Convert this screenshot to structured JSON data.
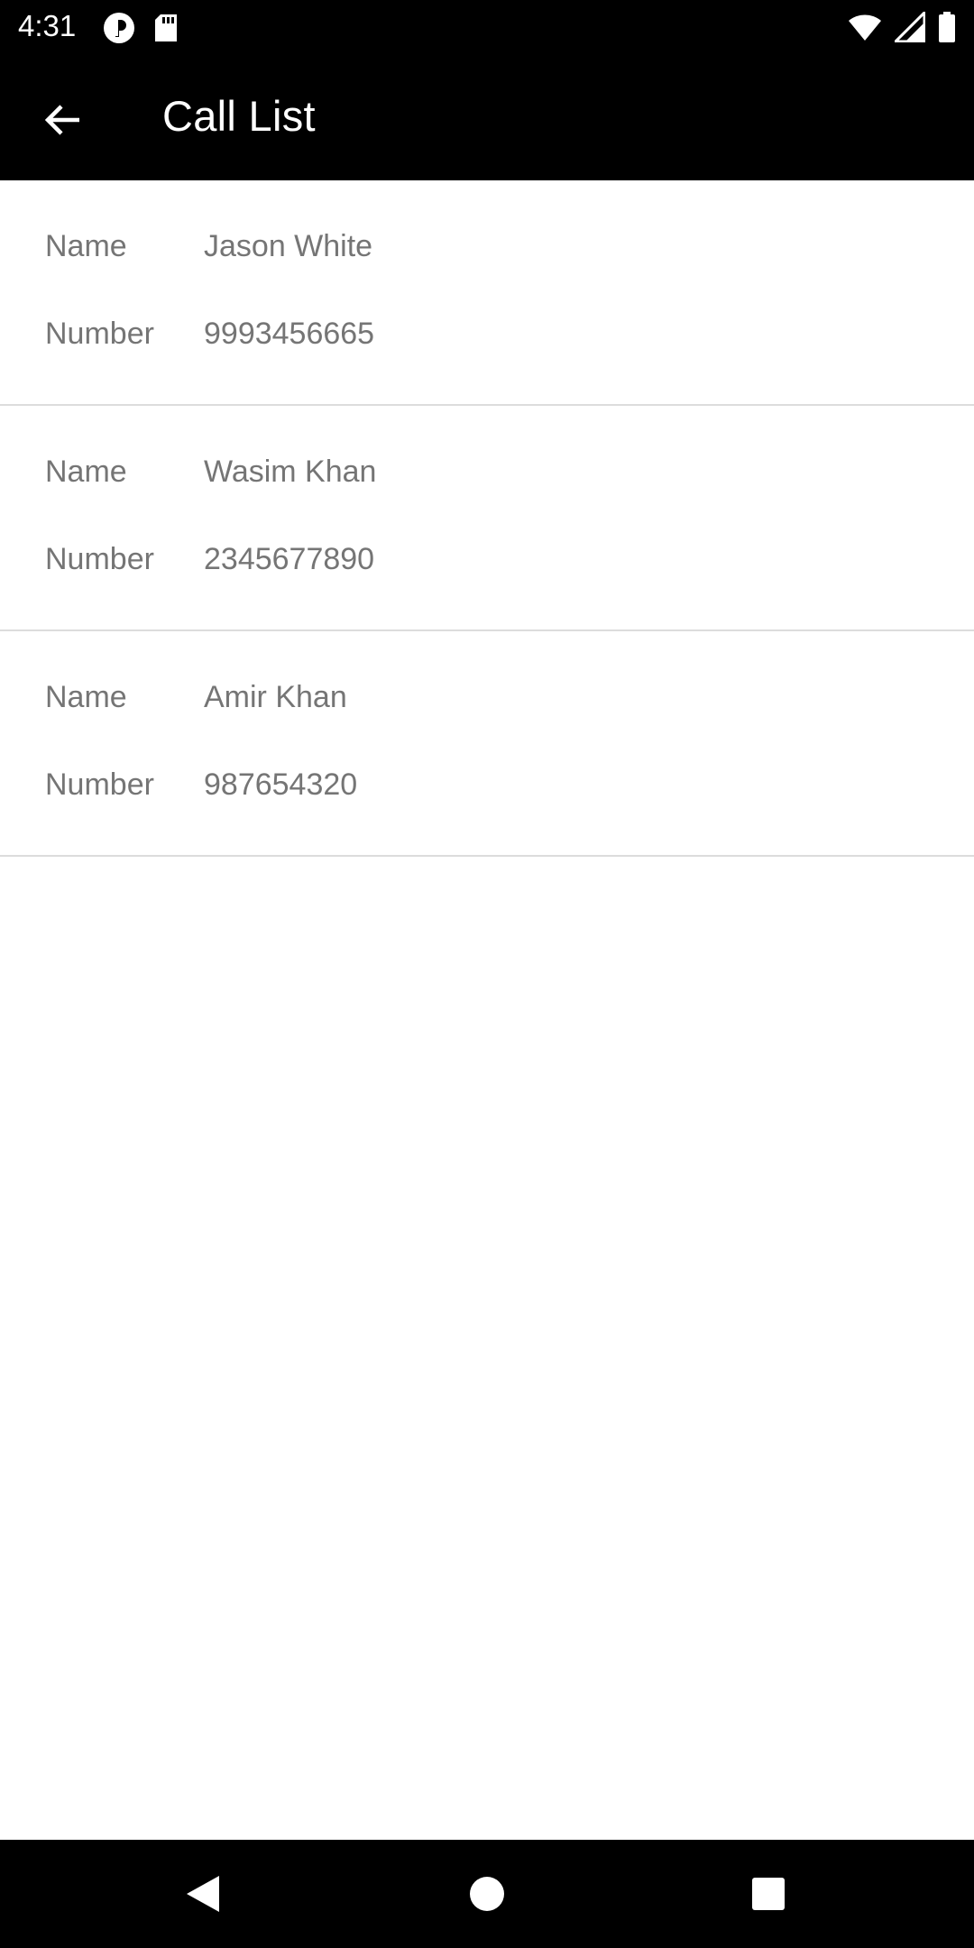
{
  "status_bar": {
    "time": "4:31",
    "left_icons": [
      "circle-p-icon",
      "sd-card-icon"
    ],
    "right_icons": [
      "wifi-icon",
      "signal-icon",
      "battery-icon"
    ]
  },
  "app_bar": {
    "back_icon": "arrow-back-icon",
    "title": "Call List"
  },
  "call_list": {
    "items": [
      {
        "name_label": "Name",
        "name": "Jason White",
        "number_label": "Number",
        "number": "9993456665"
      },
      {
        "name_label": "Name",
        "name": "Wasim Khan",
        "number_label": "Number",
        "number": "2345677890"
      },
      {
        "name_label": "Name",
        "name": "Amir Khan",
        "number_label": "Number",
        "number": "987654320"
      }
    ]
  },
  "nav_bar": {
    "icons": [
      "back-triangle-icon",
      "home-circle-icon",
      "recents-square-icon"
    ]
  },
  "colors": {
    "bar_background": "#000000",
    "text_secondary": "#757575",
    "divider": "#dcdcdc"
  }
}
